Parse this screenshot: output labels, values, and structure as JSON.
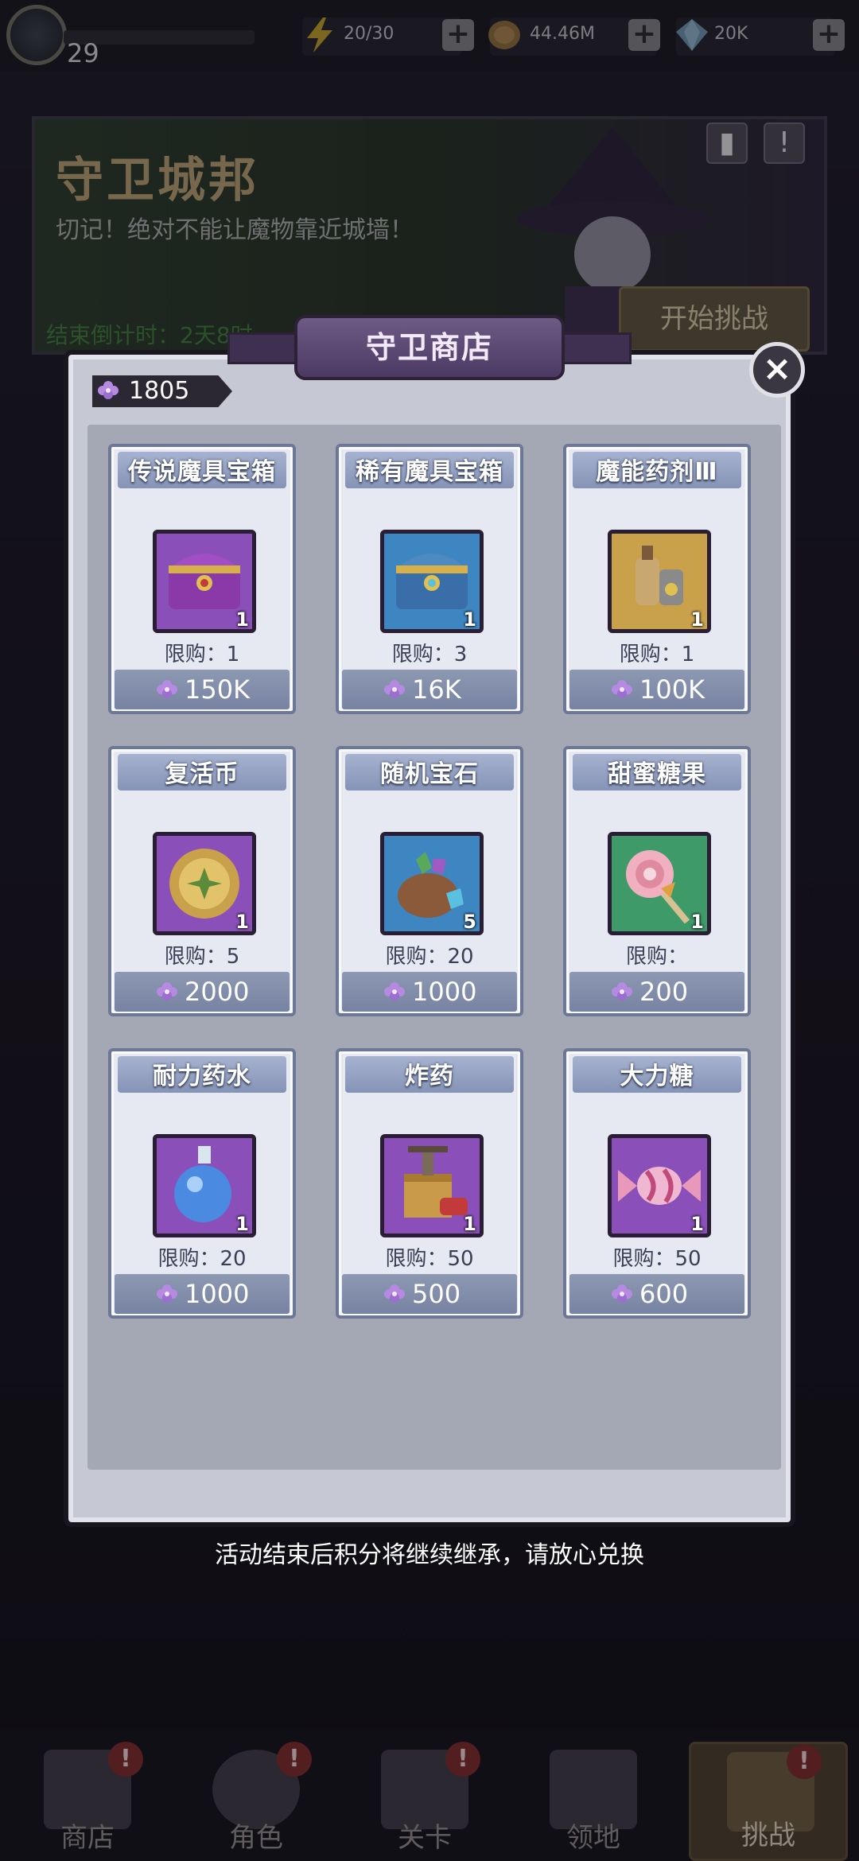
{
  "hud": {
    "level": "29",
    "energy": "20/30",
    "gold": "44.46M",
    "gems": "20K"
  },
  "banner": {
    "title": "守卫城邦",
    "subtitle": "切记！绝对不能让魔物靠近城墙！",
    "timer": "结束倒计时：2天8时",
    "start_button": "开始挑战"
  },
  "shop": {
    "title": "守卫商店",
    "currency_amount": "1805",
    "footer_note": "活动结束后积分将继续继承，请放心兑换",
    "items": [
      {
        "name": "传说魔具宝箱",
        "qty": "1",
        "limit": "限购：1",
        "price": "150K",
        "icon": "purple-chest-icon",
        "frame": "#8a4fb8"
      },
      {
        "name": "稀有魔具宝箱",
        "qty": "1",
        "limit": "限购：3",
        "price": "16K",
        "icon": "blue-chest-icon",
        "frame": "#3d86c2"
      },
      {
        "name": "魔能药剂Ⅲ",
        "qty": "1",
        "limit": "限购：1",
        "price": "100K",
        "icon": "potion-set-icon",
        "frame": "#c9a14a"
      },
      {
        "name": "复活币",
        "qty": "1",
        "limit": "限购：5",
        "price": "2000",
        "icon": "revive-coin-icon",
        "frame": "#8a4fb8"
      },
      {
        "name": "随机宝石",
        "qty": "5",
        "limit": "限购：20",
        "price": "1000",
        "icon": "gem-bag-icon",
        "frame": "#3d86c2"
      },
      {
        "name": "甜蜜糖果",
        "qty": "1",
        "limit": "限购：",
        "price": "200",
        "icon": "lollipop-icon",
        "frame": "#3f9a6a"
      },
      {
        "name": "耐力药水",
        "qty": "1",
        "limit": "限购：20",
        "price": "1000",
        "icon": "blue-potion-icon",
        "frame": "#8a4fb8"
      },
      {
        "name": "炸药",
        "qty": "1",
        "limit": "限购：50",
        "price": "500",
        "icon": "dynamite-icon",
        "frame": "#8a4fb8"
      },
      {
        "name": "大力糖",
        "qty": "1",
        "limit": "限购：50",
        "price": "600",
        "icon": "candy-icon",
        "frame": "#8a4fb8"
      }
    ]
  },
  "nav": {
    "shop": "商店",
    "hero": "角色",
    "stage": "关卡",
    "territory": "领地",
    "challenge": "挑战"
  }
}
